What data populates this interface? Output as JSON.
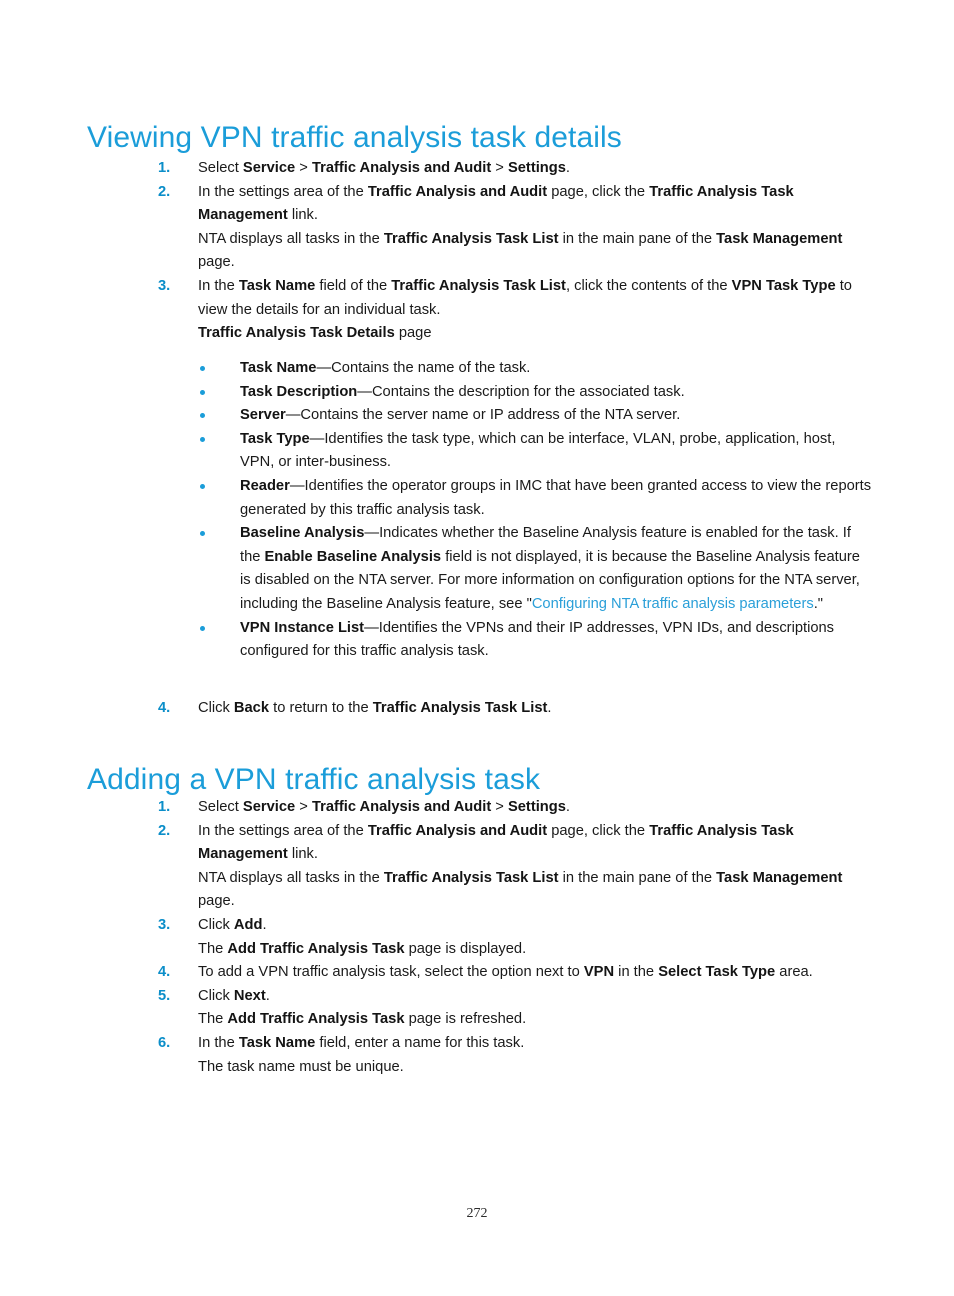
{
  "document": {
    "page_number": "272",
    "heading_color": "#1b9dd9",
    "marker_color": "#0b8ec9",
    "link_color": "#2a9fd8",
    "body_color": "#1a1a1a"
  },
  "sections": [
    {
      "heading": "Viewing VPN traffic analysis task details",
      "steps": [
        {
          "num": "1.",
          "parts": [
            {
              "t": "Select ",
              "s": "n"
            },
            {
              "t": "Service",
              "s": "b"
            },
            {
              "t": " > ",
              "s": "n"
            },
            {
              "t": "Traffic Analysis and Audit",
              "s": "b"
            },
            {
              "t": " > ",
              "s": "n"
            },
            {
              "t": "Settings",
              "s": "b"
            },
            {
              "t": ".",
              "s": "n"
            }
          ]
        },
        {
          "num": "2.",
          "parts": [
            {
              "t": "In the settings area of the ",
              "s": "n"
            },
            {
              "t": "Traffic Analysis and Audit",
              "s": "b"
            },
            {
              "t": " page, click the ",
              "s": "n"
            },
            {
              "t": "Traffic Analysis Task Management",
              "s": "b"
            },
            {
              "t": " link.",
              "s": "n"
            }
          ]
        },
        {
          "num": "",
          "cont": true,
          "parts": [
            {
              "t": "NTA displays all tasks in the ",
              "s": "n"
            },
            {
              "t": "Traffic Analysis Task List",
              "s": "b"
            },
            {
              "t": " in the main pane of the ",
              "s": "n"
            },
            {
              "t": "Task Management",
              "s": "b"
            },
            {
              "t": " page.",
              "s": "n"
            }
          ]
        },
        {
          "num": "3.",
          "parts": [
            {
              "t": "In the ",
              "s": "n"
            },
            {
              "t": "Task Name",
              "s": "b"
            },
            {
              "t": " field of the ",
              "s": "n"
            },
            {
              "t": "Traffic Analysis Task List",
              "s": "b"
            },
            {
              "t": ", click the contents of the ",
              "s": "n"
            },
            {
              "t": "VPN Task Type",
              "s": "b"
            },
            {
              "t": " to view the details for an individual task.",
              "s": "n"
            }
          ]
        },
        {
          "num": "",
          "cont": true,
          "parts": [
            {
              "t": "Traffic Analysis Task Details",
              "s": "b"
            },
            {
              "t": " page",
              "s": "n"
            }
          ]
        }
      ],
      "bullets": [
        {
          "parts": [
            {
              "t": "Task Name",
              "s": "b"
            },
            {
              "t": "—Contains the name of the task.",
              "s": "n"
            }
          ]
        },
        {
          "parts": [
            {
              "t": "Task Description",
              "s": "b"
            },
            {
              "t": "—Contains the description for the associated task.",
              "s": "n"
            }
          ]
        },
        {
          "parts": [
            {
              "t": "Server",
              "s": "b"
            },
            {
              "t": "—Contains the server name or IP address of the NTA server.",
              "s": "n"
            }
          ]
        },
        {
          "parts": [
            {
              "t": "Task Type",
              "s": "b"
            },
            {
              "t": "—Identifies the task type, which can be interface, VLAN, probe, application, host, VPN, or inter-business.",
              "s": "n"
            }
          ]
        },
        {
          "parts": [
            {
              "t": "Reader",
              "s": "b"
            },
            {
              "t": "—Identifies the operator groups in IMC that have been granted access to view the reports generated by this traffic analysis task.",
              "s": "n"
            }
          ]
        },
        {
          "parts": [
            {
              "t": "Baseline Analysis",
              "s": "b"
            },
            {
              "t": "—Indicates whether the Baseline Analysis feature is enabled for the task. If the ",
              "s": "n"
            },
            {
              "t": "Enable Baseline Analysis",
              "s": "b"
            },
            {
              "t": " field is not displayed, it is because the Baseline Analysis feature is disabled on the NTA server. For more information on configuration options for the NTA server, including the Baseline Analysis feature, see \"",
              "s": "n"
            },
            {
              "t": "Configuring NTA traffic analysis parameters",
              "s": "link"
            },
            {
              "t": ".\"",
              "s": "n"
            }
          ]
        },
        {
          "parts": [
            {
              "t": "VPN Instance List",
              "s": "b"
            },
            {
              "t": "—Identifies the VPNs and their IP addresses, VPN IDs, and descriptions configured for this traffic analysis task.",
              "s": "n"
            }
          ]
        }
      ],
      "final_steps": [
        {
          "num": "4.",
          "parts": [
            {
              "t": "Click ",
              "s": "n"
            },
            {
              "t": "Back",
              "s": "b"
            },
            {
              "t": " to return to the ",
              "s": "n"
            },
            {
              "t": "Traffic Analysis Task List",
              "s": "b"
            },
            {
              "t": ".",
              "s": "n"
            }
          ]
        }
      ]
    },
    {
      "heading": "Adding a VPN traffic analysis task",
      "steps": [
        {
          "num": "1.",
          "parts": [
            {
              "t": "Select ",
              "s": "n"
            },
            {
              "t": "Service",
              "s": "b"
            },
            {
              "t": " > ",
              "s": "n"
            },
            {
              "t": "Traffic Analysis and Audit",
              "s": "b"
            },
            {
              "t": " > ",
              "s": "n"
            },
            {
              "t": "Settings",
              "s": "b"
            },
            {
              "t": ".",
              "s": "n"
            }
          ]
        },
        {
          "num": "2.",
          "parts": [
            {
              "t": "In the settings area of the ",
              "s": "n"
            },
            {
              "t": "Traffic Analysis and Audit",
              "s": "b"
            },
            {
              "t": " page, click the ",
              "s": "n"
            },
            {
              "t": "Traffic Analysis Task Management",
              "s": "b"
            },
            {
              "t": " link.",
              "s": "n"
            }
          ]
        },
        {
          "num": "",
          "cont": true,
          "parts": [
            {
              "t": "NTA displays all tasks in the ",
              "s": "n"
            },
            {
              "t": "Traffic Analysis Task List",
              "s": "b"
            },
            {
              "t": " in the main pane of the ",
              "s": "n"
            },
            {
              "t": "Task Management",
              "s": "b"
            },
            {
              "t": " page.",
              "s": "n"
            }
          ]
        },
        {
          "num": "3.",
          "parts": [
            {
              "t": "Click ",
              "s": "n"
            },
            {
              "t": "Add",
              "s": "b"
            },
            {
              "t": ".",
              "s": "n"
            }
          ]
        },
        {
          "num": "",
          "cont": true,
          "parts": [
            {
              "t": "The ",
              "s": "n"
            },
            {
              "t": "Add Traffic Analysis Task",
              "s": "b"
            },
            {
              "t": " page is displayed.",
              "s": "n"
            }
          ]
        },
        {
          "num": "4.",
          "parts": [
            {
              "t": "To add a VPN traffic analysis task, select the option next to ",
              "s": "n"
            },
            {
              "t": "VPN",
              "s": "b"
            },
            {
              "t": " in the ",
              "s": "n"
            },
            {
              "t": "Select Task Type",
              "s": "b"
            },
            {
              "t": " area.",
              "s": "n"
            }
          ]
        },
        {
          "num": "5.",
          "parts": [
            {
              "t": "Click ",
              "s": "n"
            },
            {
              "t": "Next",
              "s": "b"
            },
            {
              "t": ".",
              "s": "n"
            }
          ]
        },
        {
          "num": "",
          "cont": true,
          "parts": [
            {
              "t": "The ",
              "s": "n"
            },
            {
              "t": "Add Traffic Analysis Task",
              "s": "b"
            },
            {
              "t": " page is refreshed.",
              "s": "n"
            }
          ]
        },
        {
          "num": "6.",
          "parts": [
            {
              "t": "In the ",
              "s": "n"
            },
            {
              "t": "Task Name",
              "s": "b"
            },
            {
              "t": " field, enter a name for this task.",
              "s": "n"
            }
          ]
        },
        {
          "num": "",
          "cont": true,
          "parts": [
            {
              "t": "The task name must be unique.",
              "s": "n"
            }
          ]
        }
      ],
      "bullets": [],
      "final_steps": []
    }
  ]
}
